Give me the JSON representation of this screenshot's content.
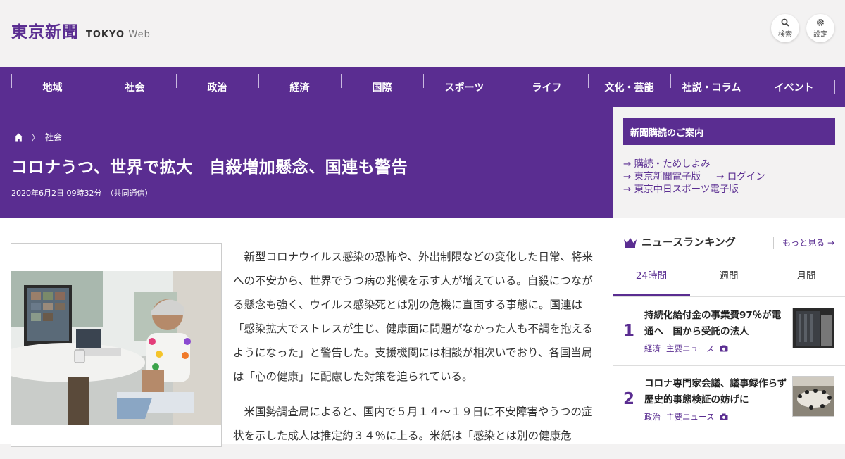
{
  "header": {
    "logo_jp": "東京新聞",
    "logo_en": "TOKYO",
    "logo_web": "Web",
    "search_label": "検索",
    "settings_label": "設定"
  },
  "nav": {
    "items": [
      "地域",
      "社会",
      "政治",
      "経済",
      "国際",
      "スポーツ",
      "ライフ",
      "文化・芸能",
      "社説・コラム",
      "イベント"
    ]
  },
  "article": {
    "breadcrumb": "社会",
    "title": "コロナうつ、世界で拡大　自殺増加懸念、国連も警告",
    "date": "2020年6月2日 09時32分",
    "source": "（共同通信）",
    "paragraphs": [
      "新型コロナウイルス感染の恐怖や、外出制限などの変化した日常、将来への不安から、世界でうつ病の兆候を示す人が増えている。自殺につながる懸念も強く、ウイルス感染死とは別の危機に直面する事態に。国連は「感染拡大でストレスが生じ、健康面に問題がなかった人も不調を抱えるようになった」と警告した。支援機関には相談が相次いでおり、各国当局は「心の健康」に配慮した対策を迫られている。",
      "米国勢調査局によると、国内で５月１４～１９日に不安障害やうつの症状を示した成人は推定約３４％に上る。米紙は「感染とは別の健康危"
    ]
  },
  "sidebar": {
    "subscription_title": "新聞購読のご案内",
    "links": [
      "購読・ためしよみ",
      "東京新聞電子版",
      "ログイン",
      "東京中日スポーツ電子版"
    ],
    "ranking_title": "ニュースランキング",
    "more_label": "もっと見る",
    "tabs": [
      "24時間",
      "週間",
      "月間"
    ],
    "ranking": [
      {
        "num": "1",
        "title": "持続化給付金の事業費97％が電通へ　国から受託の法人",
        "tags": [
          "経済",
          "主要ニュース"
        ]
      },
      {
        "num": "2",
        "title": "コロナ専門家会議、議事録作らず　歴史的事態検証の妨げに",
        "tags": [
          "政治",
          "主要ニュース"
        ]
      }
    ]
  },
  "colors": {
    "brand": "#5a2d91",
    "background": "#f3f2f2"
  }
}
